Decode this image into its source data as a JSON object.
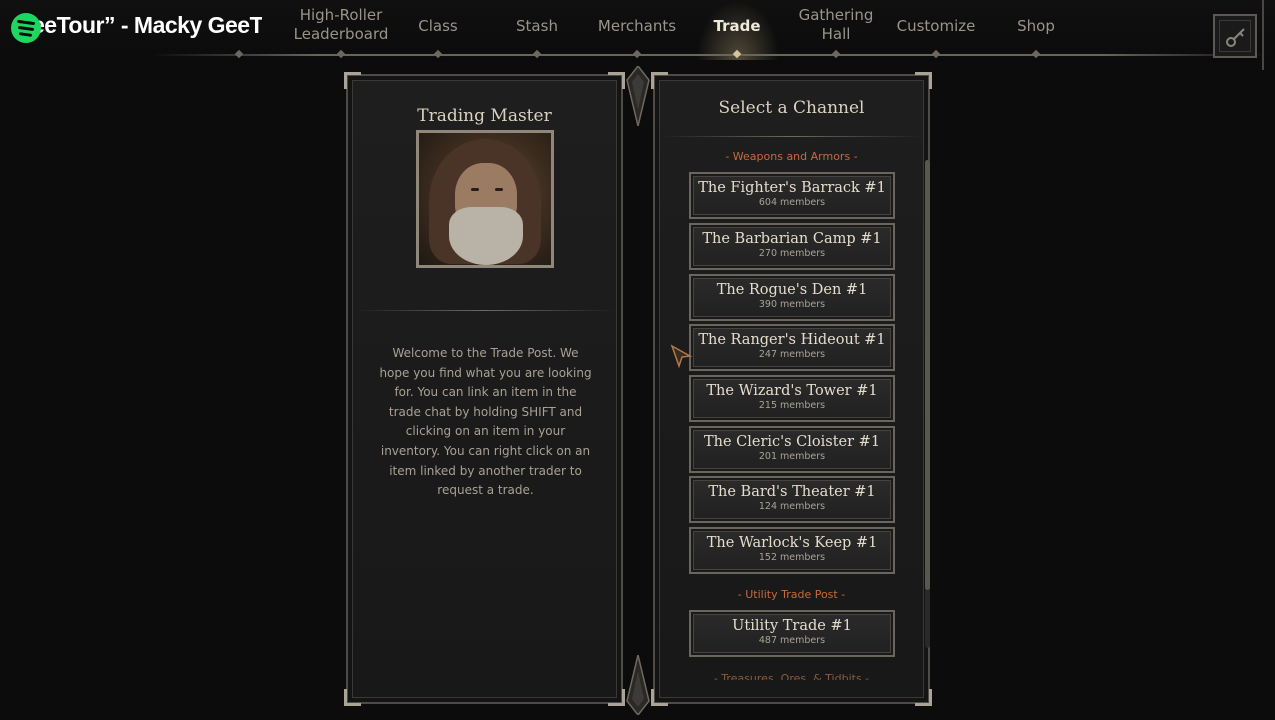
{
  "overlay": {
    "song_title": "eeTour” - Macky GeeTou"
  },
  "nav": {
    "items": [
      {
        "label": "High-Roller Leaderboard",
        "line1": "High-Roller",
        "line2": "Leaderboard"
      },
      {
        "label": "Class"
      },
      {
        "label": "Stash"
      },
      {
        "label": "Merchants"
      },
      {
        "label": "Trade"
      },
      {
        "label": "Gathering Hall",
        "line1": "Gathering",
        "line2": "Hall"
      },
      {
        "label": "Customize"
      },
      {
        "label": "Shop"
      }
    ],
    "active": "Trade"
  },
  "trading_master": {
    "title": "Trading Master",
    "description": "Welcome to the Trade Post. We hope you find what you are looking for. You can link an item in the trade chat by holding SHIFT and clicking on an item in your inventory. You can right click on an item linked by another trader to request a trade."
  },
  "channels": {
    "title": "Select a Channel",
    "sections": [
      {
        "label": "- Weapons and Armors -",
        "items": [
          {
            "name": "The Fighter's Barrack #1",
            "members": "604 members"
          },
          {
            "name": "The Barbarian Camp #1",
            "members": "270 members"
          },
          {
            "name": "The Rogue's Den #1",
            "members": "390 members"
          },
          {
            "name": "The Ranger's Hideout #1",
            "members": "247 members"
          },
          {
            "name": "The Wizard's Tower #1",
            "members": "215 members"
          },
          {
            "name": "The Cleric's Cloister #1",
            "members": "201 members"
          },
          {
            "name": "The Bard's Theater #1",
            "members": "124 members"
          },
          {
            "name": "The Warlock's Keep #1",
            "members": "152 members"
          }
        ]
      },
      {
        "label": "- Utility Trade Post -",
        "items": [
          {
            "name": "Utility Trade #1",
            "members": "487 members"
          }
        ]
      },
      {
        "label": "- Treasures, Ores, & Tidbits -",
        "items": []
      }
    ]
  },
  "colors": {
    "accent_orange": "#c76a3c",
    "spotify_green": "#1ed760",
    "active_nav": "#f0ead8"
  }
}
